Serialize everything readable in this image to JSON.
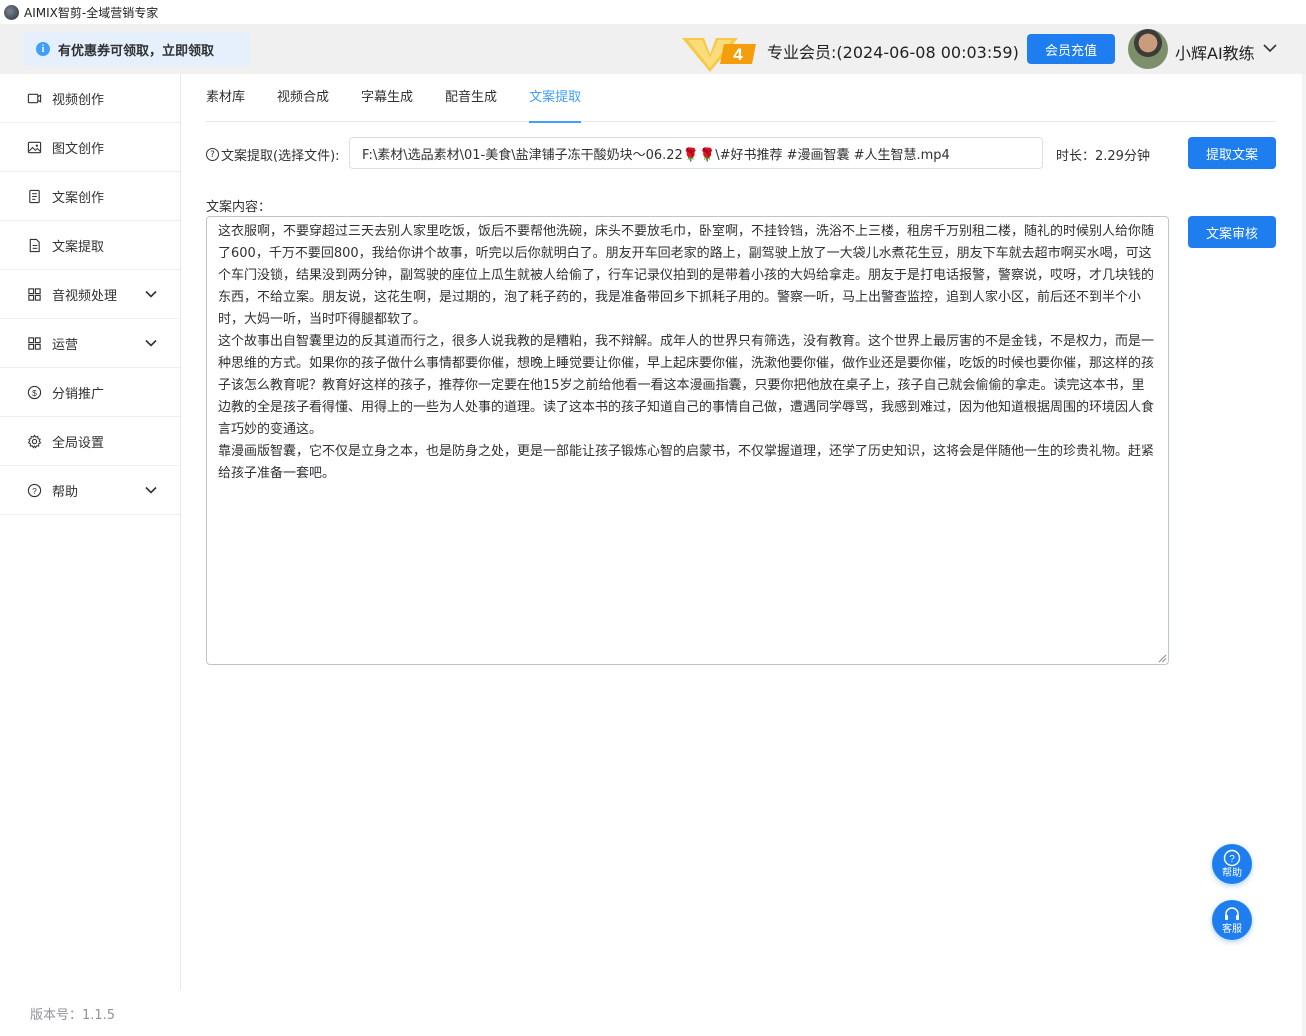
{
  "window": {
    "title": "AIMIX智剪-全域营销专家"
  },
  "header": {
    "promo_text": "有优惠券可领取，立即领取",
    "vip_level": "4",
    "member_text": "专业会员:(2024-06-08 00:03:59)",
    "recharge_label": "会员充值",
    "user_name": "小辉AI教练"
  },
  "sidebar": {
    "items": [
      {
        "label": "视频创作",
        "icon": "video-icon",
        "has_submenu": false
      },
      {
        "label": "图文创作",
        "icon": "image-icon",
        "has_submenu": false
      },
      {
        "label": "文案创作",
        "icon": "document-icon",
        "has_submenu": false
      },
      {
        "label": "文案提取",
        "icon": "file-extract-icon",
        "has_submenu": false
      },
      {
        "label": "音视频处理",
        "icon": "grid-icon",
        "has_submenu": true
      },
      {
        "label": "运营",
        "icon": "grid-icon",
        "has_submenu": true
      },
      {
        "label": "分销推广",
        "icon": "dollar-icon",
        "has_submenu": false
      },
      {
        "label": "全局设置",
        "icon": "gear-icon",
        "has_submenu": false
      },
      {
        "label": "帮助",
        "icon": "question-icon",
        "has_submenu": true
      }
    ],
    "version": "版本号：1.1.5"
  },
  "tabs": [
    {
      "label": "素材库",
      "active": false
    },
    {
      "label": "视频合成",
      "active": false
    },
    {
      "label": "字幕生成",
      "active": false
    },
    {
      "label": "配音生成",
      "active": false
    },
    {
      "label": "文案提取",
      "active": true
    }
  ],
  "extract": {
    "file_label": "文案提取(选择文件):",
    "file_path": "F:\\素材\\选品素材\\01-美食\\盐津铺子冻干酸奶块～06.22🌹🌹\\#好书推荐 #漫画智囊 #人生智慧.mp4",
    "duration": "时长：2.29分钟",
    "extract_button": "提取文案"
  },
  "content": {
    "label": "文案内容：",
    "text": "这衣服啊，不要穿超过三天去别人家里吃饭，饭后不要帮他洗碗，床头不要放毛巾，卧室啊，不挂铃铛，洗浴不上三楼，租房千万别租二楼，随礼的时候别人给你随了600，千万不要回800，我给你讲个故事，听完以后你就明白了。朋友开车回老家的路上，副驾驶上放了一大袋儿水煮花生豆，朋友下车就去超市啊买水喝，可这个车门没锁，结果没到两分钟，副驾驶的座位上瓜生就被人给偷了，行车记录仪拍到的是带着小孩的大妈给拿走。朋友于是打电话报警，警察说，哎呀，才几块钱的东西，不给立案。朋友说，这花生啊，是过期的，泡了耗子药的，我是准备带回乡下抓耗子用的。警察一听，马上出警查监控，追到人家小区，前后还不到半个小时，大妈一听，当时吓得腿都软了。\n这个故事出自智囊里边的反其道而行之，很多人说我教的是糟粕，我不辩解。成年人的世界只有筛选，没有教育。这个世界上最厉害的不是金钱，不是权力，而是一种思维的方式。如果你的孩子做什么事情都要你催，想晚上睡觉要让你催，早上起床要你催，洗漱他要你催，做作业还是要你催，吃饭的时候也要你催，那这样的孩子该怎么教育呢？教育好这样的孩子，推荐你一定要在他15岁之前给他看一看这本漫画指囊，只要你把他放在桌子上，孩子自己就会偷偷的拿走。读完这本书，里边教的全是孩子看得懂、用得上的一些为人处事的道理。读了这本书的孩子知道自己的事情自己做，遭遇同学辱骂，我感到难过，因为他知道根据周围的环境因人食言巧妙的变通这。\n靠漫画版智囊，它不仅是立身之本，也是防身之处，更是一部能让孩子锻炼心智的启蒙书，不仅掌握道理，还学了历史知识，这将会是伴随他一生的珍贵礼物。赶紧给孩子准备一套吧。",
    "audit_button": "文案审核"
  },
  "floating": {
    "help_label": "帮助",
    "service_label": "客服"
  },
  "colors": {
    "accent": "#1e7ef0",
    "active_tab": "#409eff"
  }
}
